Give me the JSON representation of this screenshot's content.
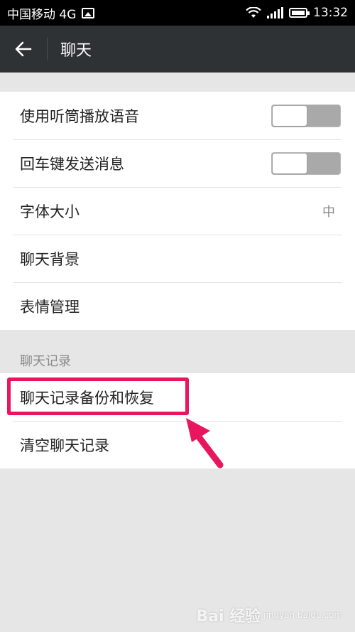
{
  "status_bar": {
    "carrier": "中国移动 4G",
    "time": "13:32"
  },
  "toolbar": {
    "back_icon": "arrow-left-icon",
    "title": "聊天"
  },
  "settings": {
    "items": [
      {
        "label": "使用听筒播放语音",
        "type": "toggle",
        "on": false
      },
      {
        "label": "回车键发送消息",
        "type": "toggle",
        "on": false
      },
      {
        "label": "字体大小",
        "type": "value",
        "value": "中"
      },
      {
        "label": "聊天背景",
        "type": "link"
      },
      {
        "label": "表情管理",
        "type": "link"
      }
    ]
  },
  "chat_history": {
    "header": "聊天记录",
    "items": [
      {
        "label": "聊天记录备份和恢复",
        "highlighted": true
      },
      {
        "label": "清空聊天记录"
      }
    ]
  },
  "colors": {
    "highlight": "#e8175d",
    "toolbar": "#2e3234",
    "background": "#e6e6e6"
  },
  "watermark": {
    "text": "Bai 经验",
    "sub": "jingyan.baidu.com"
  }
}
